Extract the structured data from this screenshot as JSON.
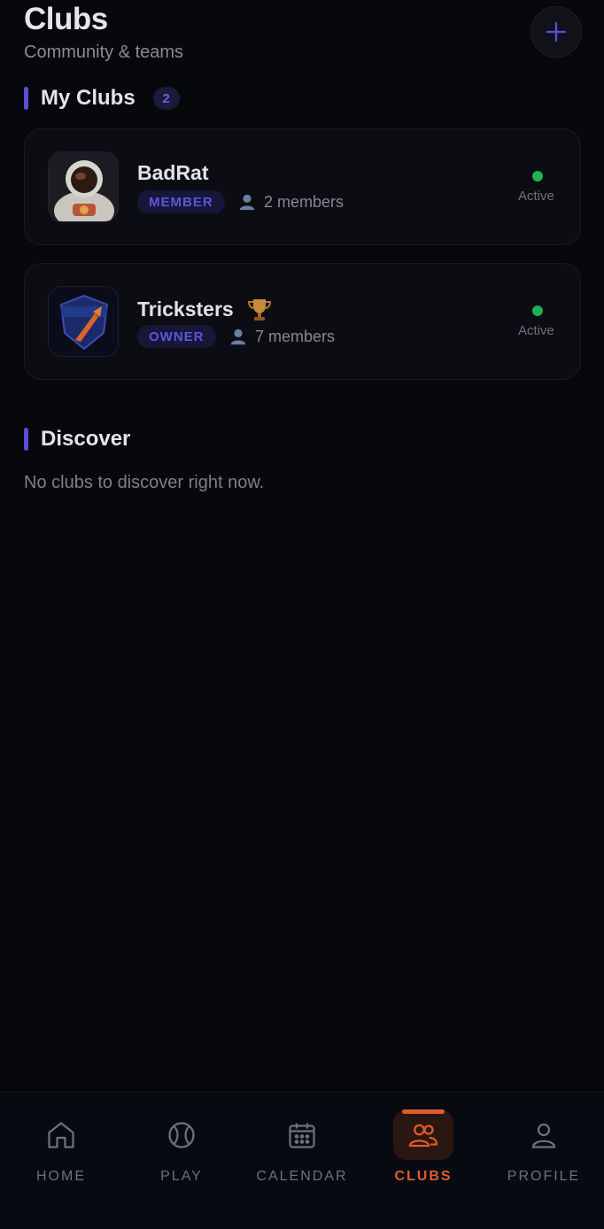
{
  "header": {
    "title": "Clubs",
    "subtitle": "Community & teams",
    "add_icon": "plus-icon"
  },
  "my_clubs": {
    "title": "My Clubs",
    "count": "2",
    "clubs": [
      {
        "name": "BadRat",
        "role": "MEMBER",
        "members": "2 members",
        "status": "Active",
        "logo": "astronaut-avatar",
        "trophy": false
      },
      {
        "name": "Tricksters",
        "role": "OWNER",
        "members": "7 members",
        "status": "Active",
        "logo": "tricksters-shield-logo",
        "trophy": true
      }
    ]
  },
  "discover": {
    "title": "Discover",
    "empty_text": "No clubs to discover right now."
  },
  "tabbar": {
    "tabs": [
      {
        "label": "HOME",
        "icon": "home-icon"
      },
      {
        "label": "PLAY",
        "icon": "ball-icon"
      },
      {
        "label": "CALENDAR",
        "icon": "calendar-icon"
      },
      {
        "label": "CLUBS",
        "icon": "users-icon",
        "active": true
      },
      {
        "label": "PROFILE",
        "icon": "person-icon"
      }
    ]
  },
  "colors": {
    "background": "#07080b",
    "accent": "#5a4fd6",
    "active_tab": "#e25a2c",
    "status_active": "#1fb155"
  }
}
